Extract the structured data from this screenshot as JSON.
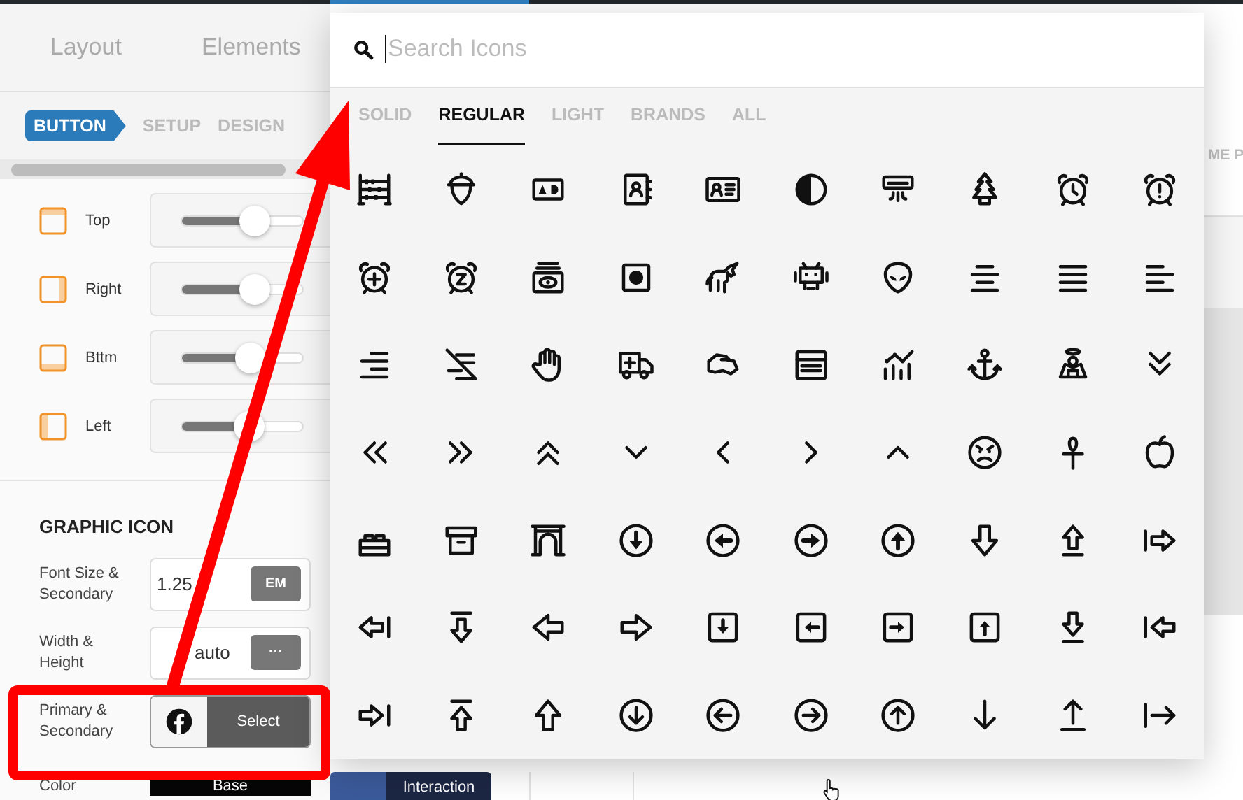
{
  "top_tabs": [
    {
      "label": "Layout",
      "selected": false
    },
    {
      "label": "Elements",
      "selected": false
    }
  ],
  "breadcrumb": [
    {
      "label": "BUTTON",
      "selected": true
    },
    {
      "label": "SETUP",
      "selected": false
    },
    {
      "label": "DESIGN",
      "selected": false
    }
  ],
  "spacing_sliders": [
    {
      "kind": "top",
      "label": "Top",
      "level": 0.6
    },
    {
      "kind": "right",
      "label": "Right",
      "level": 0.6
    },
    {
      "kind": "bottom",
      "label": "Bttm",
      "level": 0.57
    },
    {
      "kind": "left",
      "label": "Left",
      "level": 0.56
    }
  ],
  "graphic_icon": {
    "title": "GRAPHIC ICON",
    "fields": [
      {
        "kind": "unit",
        "label": "Font Size & Secondary",
        "value": "1.25",
        "button": "EM"
      },
      {
        "kind": "unit",
        "label": "Width & Height",
        "value": "auto",
        "button": "···"
      },
      {
        "kind": "icon_select",
        "label": "Primary & Secondary",
        "button": "Select"
      }
    ]
  },
  "color_row": {
    "label": "Color",
    "base_button": "Base",
    "interaction_button": "Interaction"
  },
  "background_heading": "ME P",
  "icon_picker": {
    "search": {
      "placeholder": "Search Icons"
    },
    "tabs": [
      {
        "label": "SOLID",
        "selected": false
      },
      {
        "label": "REGULAR",
        "selected": true
      },
      {
        "label": "LIGHT",
        "selected": false
      },
      {
        "label": "BRANDS",
        "selected": false
      },
      {
        "label": "ALL",
        "selected": false
      }
    ]
  }
}
